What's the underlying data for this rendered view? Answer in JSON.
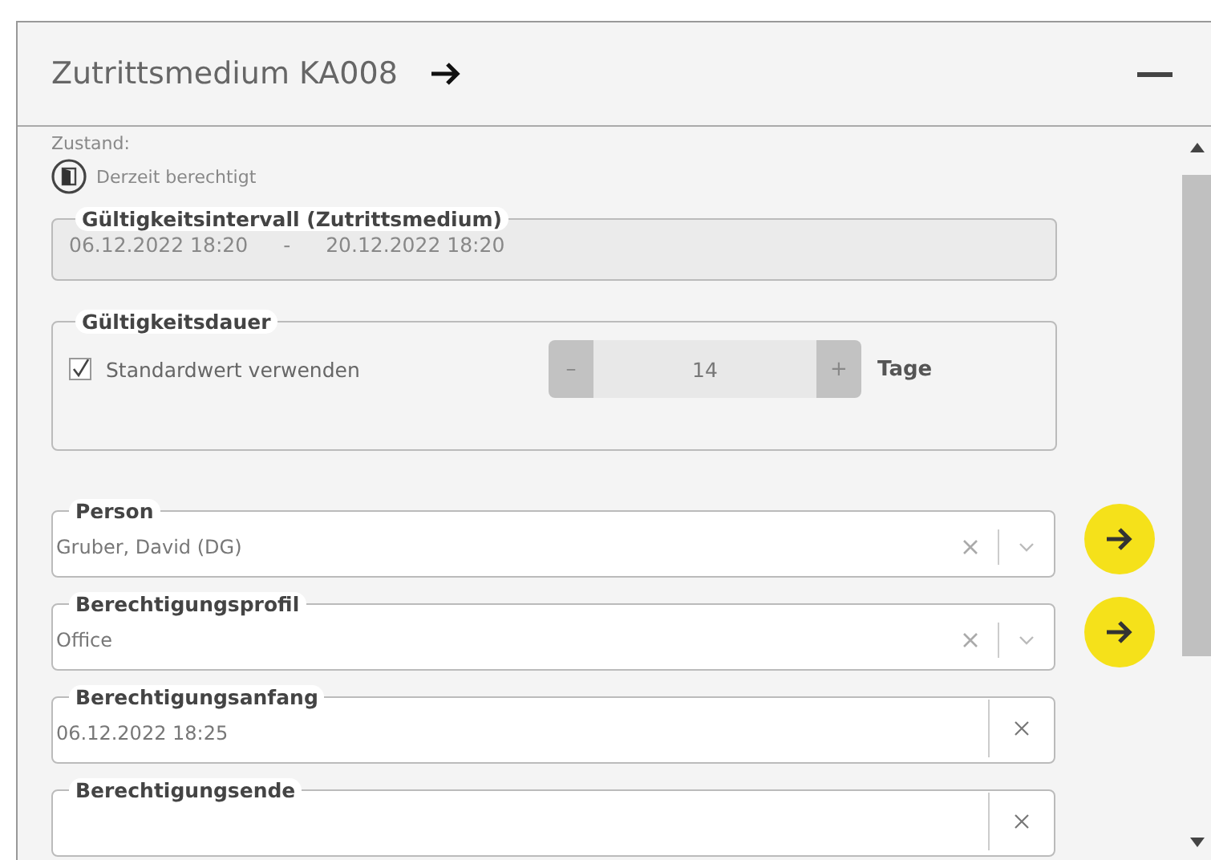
{
  "panel": {
    "title": "Zutrittsmedium KA008"
  },
  "status": {
    "label": "Zustand:",
    "text": "Derzeit berechtigt"
  },
  "validity_interval": {
    "label": "Gültigkeitsintervall (Zutrittsmedium)",
    "from": "06.12.2022 18:20",
    "separator": "-",
    "to": "20.12.2022 18:20"
  },
  "validity_duration": {
    "label": "Gültigkeitsdauer",
    "checkbox": {
      "label": "Standardwert verwenden",
      "checked": true
    },
    "stepper": {
      "minus": "–",
      "value": "14",
      "plus": "+"
    },
    "unit": "Tage"
  },
  "fields": [
    {
      "kind": "combo",
      "label": "Person",
      "value": "Gruber, David (DG)"
    },
    {
      "kind": "combo",
      "label": "Berechtigungsprofil",
      "value": "Office"
    },
    {
      "kind": "date",
      "label": "Berechtigungsanfang",
      "value": "06.12.2022 18:25"
    },
    {
      "kind": "date",
      "label": "Berechtigungsende"
    }
  ]
}
